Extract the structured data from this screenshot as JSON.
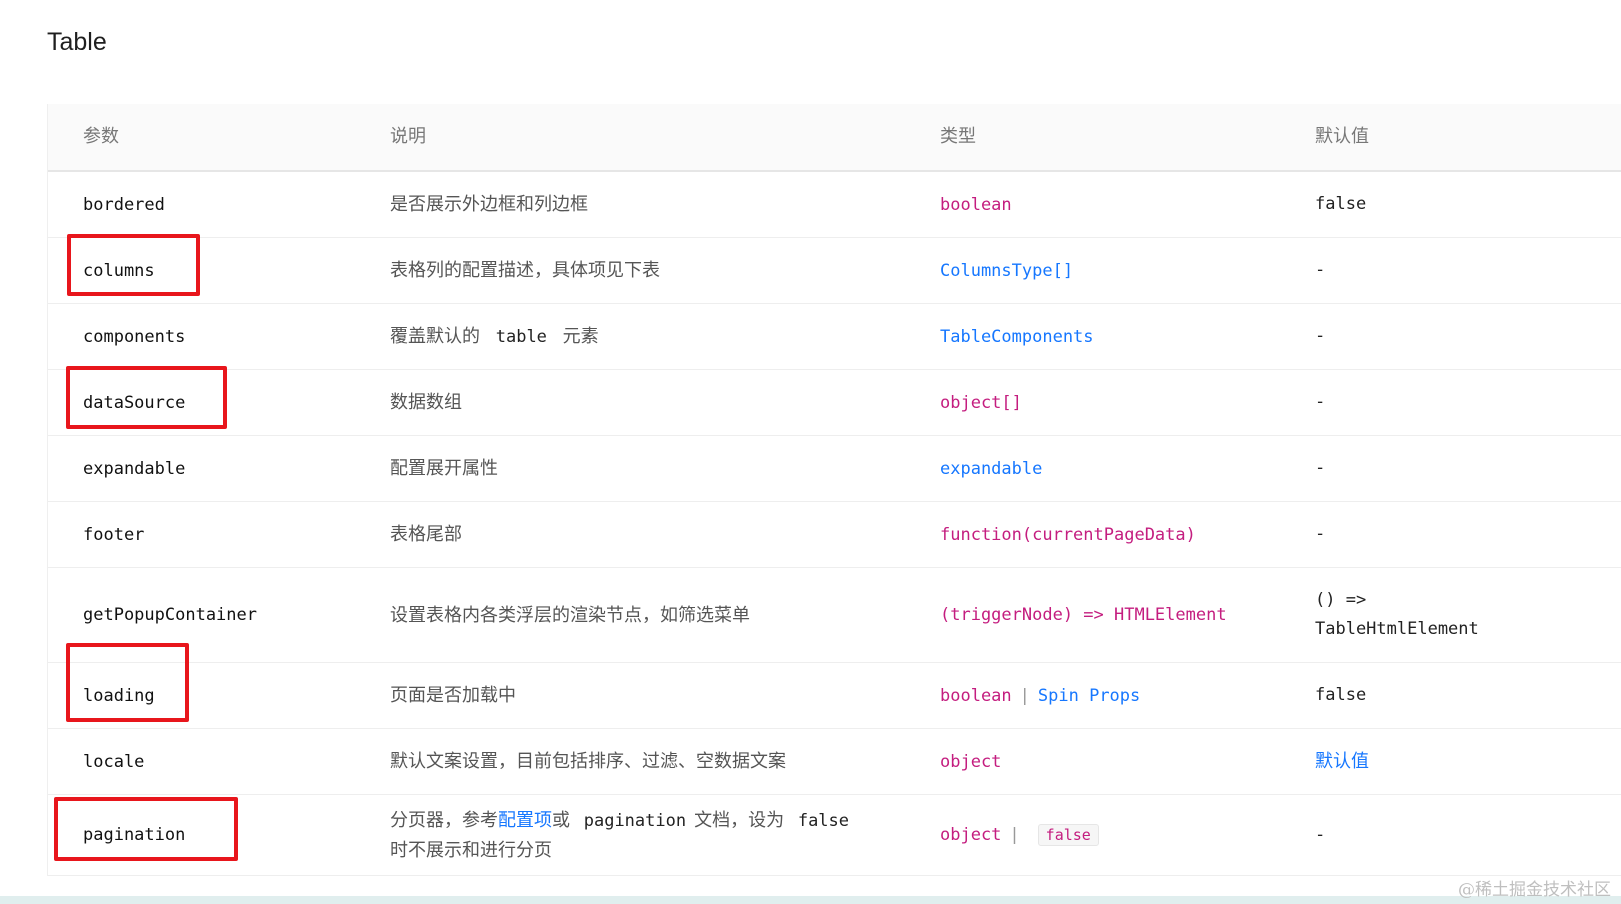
{
  "title": "Table",
  "headers": [
    "参数",
    "说明",
    "类型",
    "默认值"
  ],
  "rows": [
    {
      "param": "bordered",
      "desc": "是否展示外边框和列边框",
      "type": "boolean",
      "default": "false"
    },
    {
      "param": "columns",
      "desc": "表格列的配置描述，具体项见下表",
      "type": "ColumnsType[]",
      "default": "-"
    },
    {
      "param": "components",
      "desc_pre": "覆盖默认的",
      "desc_code": "table",
      "desc_post": "元素",
      "type": "TableComponents",
      "default": "-"
    },
    {
      "param": "dataSource",
      "desc": "数据数组",
      "type": "object[]",
      "default": "-"
    },
    {
      "param": "expandable",
      "desc": "配置展开属性",
      "type": "expandable",
      "default": "-"
    },
    {
      "param": "footer",
      "desc": "表格尾部",
      "type": "function(currentPageData)",
      "default": "-"
    },
    {
      "param": "getPopupContainer",
      "desc": "设置表格内各类浮层的渲染节点，如筛选菜单",
      "type": "(triggerNode) => HTMLElement",
      "default_line1": "() =>",
      "default_line2": "TableHtmlElement"
    },
    {
      "param": "loading",
      "desc": "页面是否加载中",
      "type_a": "boolean",
      "type_sep": "|",
      "type_b": "Spin Props",
      "default": "false"
    },
    {
      "param": "locale",
      "desc": "默认文案设置，目前包括排序、过滤、空数据文案",
      "type": "object",
      "default": "默认值"
    },
    {
      "param": "pagination",
      "desc_a": "分页器，参考",
      "desc_link1": "配置项",
      "desc_b": "或",
      "desc_link2": "pagination",
      "desc_c": "文档，设为",
      "desc_code": "false",
      "desc_line2": "时不展示和进行分页",
      "type_a": "object",
      "type_sep": "|",
      "type_tag": "false",
      "default": "-"
    }
  ],
  "watermark": "@稀土掘金技术社区",
  "colors": {
    "pink": "#c41d7f",
    "blue": "#1677ff",
    "highlight": "#e8161c"
  }
}
